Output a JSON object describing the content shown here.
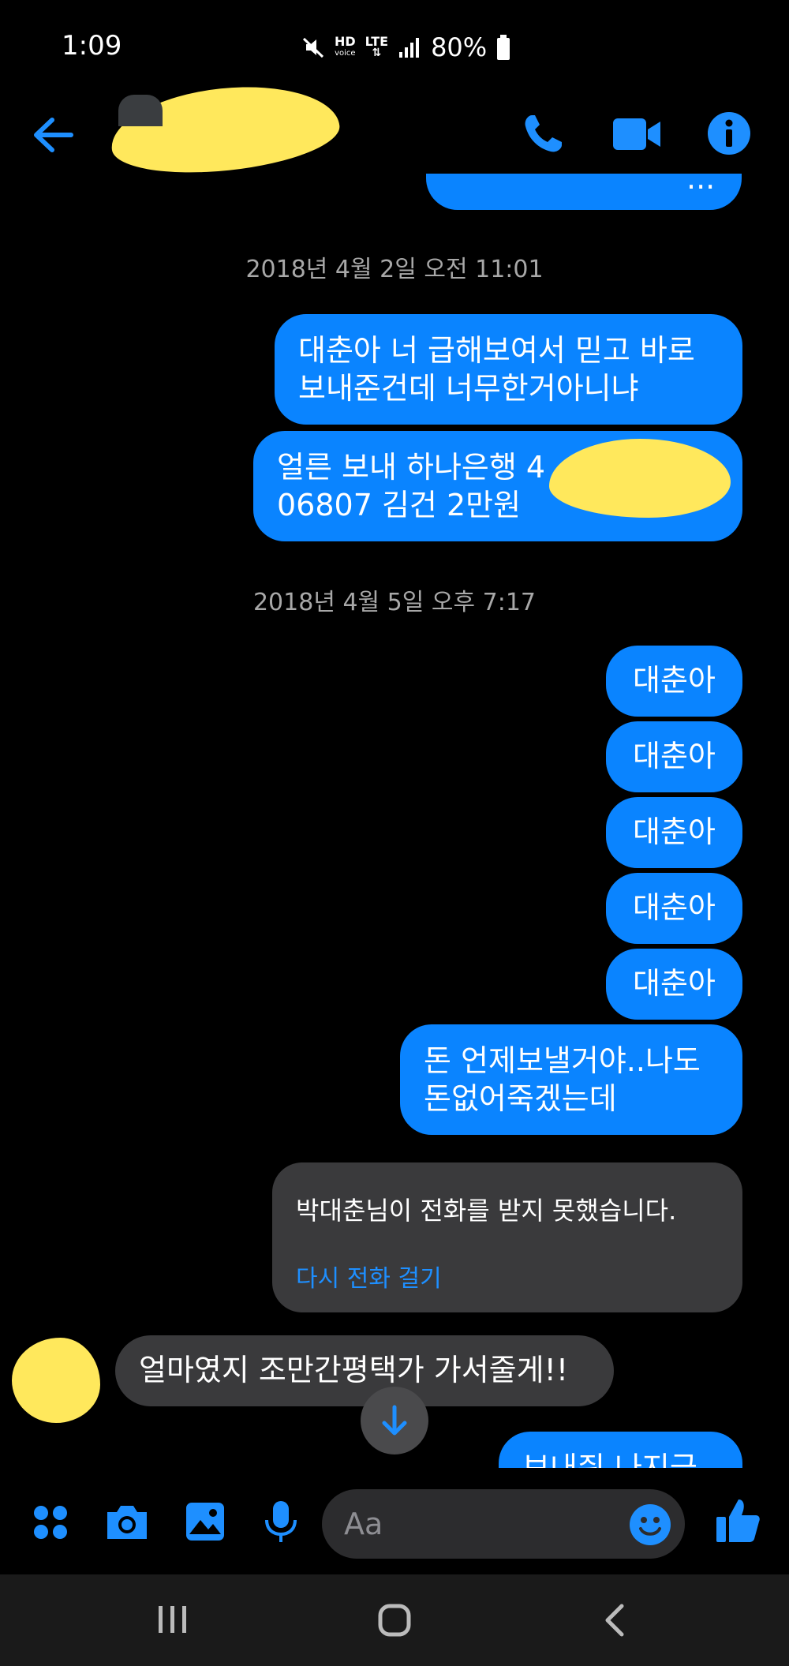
{
  "status_bar": {
    "time": "1:09",
    "hd_label": "HD",
    "voice_label": "voice",
    "lte_label": "LTE",
    "battery": "80%"
  },
  "header": {
    "back_icon": "arrow-left-icon",
    "call_icon": "phone-icon",
    "video_icon": "video-camera-icon",
    "info_icon": "info-icon",
    "accent_color": "#1e8fff"
  },
  "thread": {
    "partial_top_text": "...",
    "timestamp1": "2018년 4월 2일 오전 11:01",
    "msg1": [
      "대춘아 너 급해보여서 믿고 바로",
      "보내준건데 너무한거아니냐"
    ],
    "msg2": [
      "얼른 보내 하나은행 4",
      "06807 김건 2만원"
    ],
    "timestamp2": "2018년 4월 5일 오후 7:17",
    "repeat_msgs": [
      "대춘아",
      "대춘아",
      "대춘아",
      "대춘아",
      "대춘아"
    ],
    "msg3": [
      "돈 언제보낼거야..나도",
      "돈없어죽겠는데"
    ],
    "missed_call_text": "박대춘님이 전화를 받지 못했습니다.",
    "call_again_link": "다시 전화 걸기",
    "incoming_msg": "얼마였지 조만간평택가 가서줄게!!",
    "partial_bottom_text": "보내줘 나지금",
    "bubble_color": "#0a84ff",
    "incoming_color": "#3a3a3c"
  },
  "composer": {
    "placeholder": "Aa",
    "icons": [
      "apps-icon",
      "camera-icon",
      "gallery-icon",
      "microphone-icon",
      "emoji-icon",
      "thumbs-up-icon"
    ]
  },
  "navbar": {
    "icons": [
      "recent-apps-icon",
      "home-icon",
      "back-icon"
    ]
  }
}
